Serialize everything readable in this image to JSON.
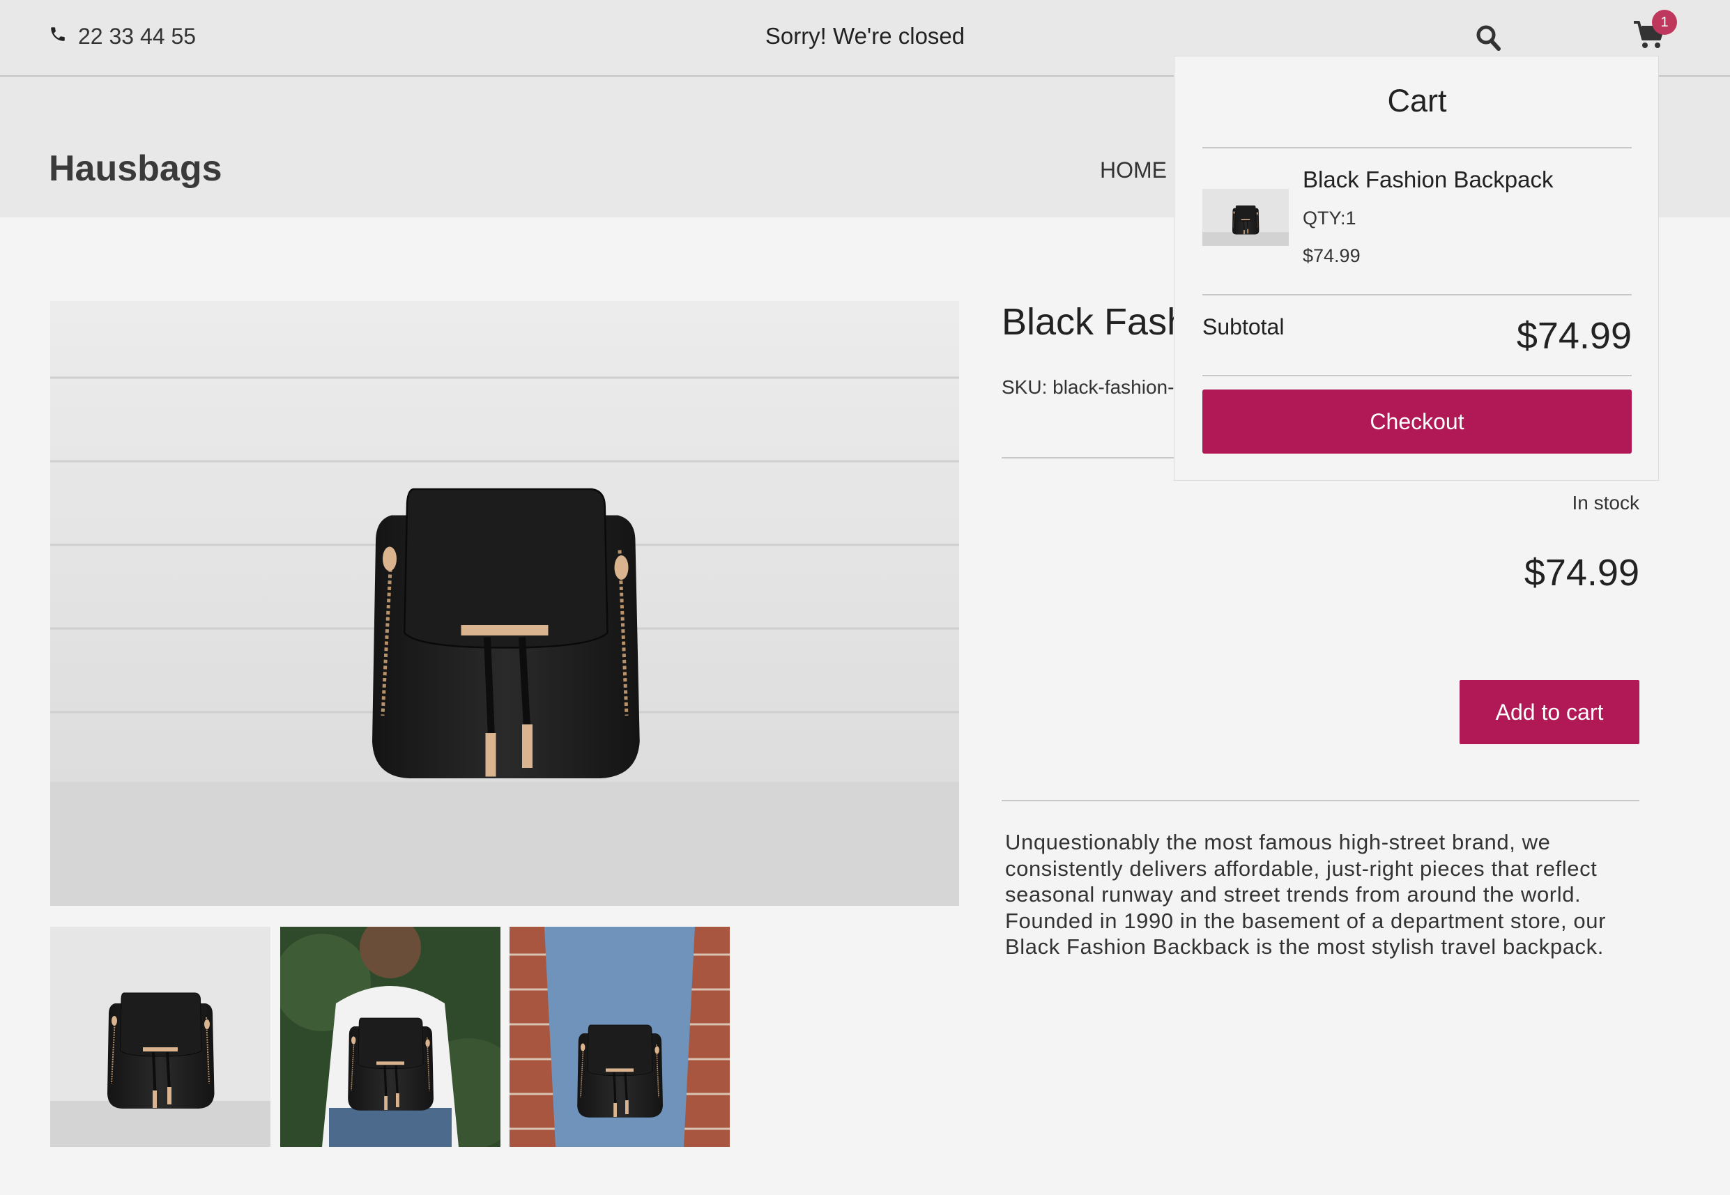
{
  "topbar": {
    "phone": "22 33 44 55",
    "status_message": "Sorry! We're closed",
    "cart_count": "1",
    "icons": [
      "phone-icon",
      "search-icon",
      "cart-icon"
    ]
  },
  "header": {
    "logo": "Hausbags",
    "nav": [
      {
        "label": "HOME"
      }
    ]
  },
  "product": {
    "title": "Black Fashion Backpack",
    "sku": "SKU: black-fashion-backpack",
    "stock": "In stock",
    "price": "$74.99",
    "add_to_cart": "Add to cart",
    "description": "Unquestionably the most famous high-street brand, we consistently delivers affordable, just-right pieces that reflect seasonal runway and street trends from around the world. Founded in 1990 in the basement of a department store, our Black Fashion Backback is the most stylish travel backpack."
  },
  "cart": {
    "title": "Cart",
    "items": [
      {
        "name": "Black Fashion Backpack",
        "qty": "QTY:1",
        "price": "$74.99"
      }
    ],
    "subtotal_label": "Subtotal",
    "subtotal_value": "$74.99",
    "checkout_label": "Checkout"
  },
  "colors": {
    "accent": "#b01956",
    "badge": "#c0375e",
    "bar": "#e8e8e8",
    "page": "#f4f4f4"
  }
}
